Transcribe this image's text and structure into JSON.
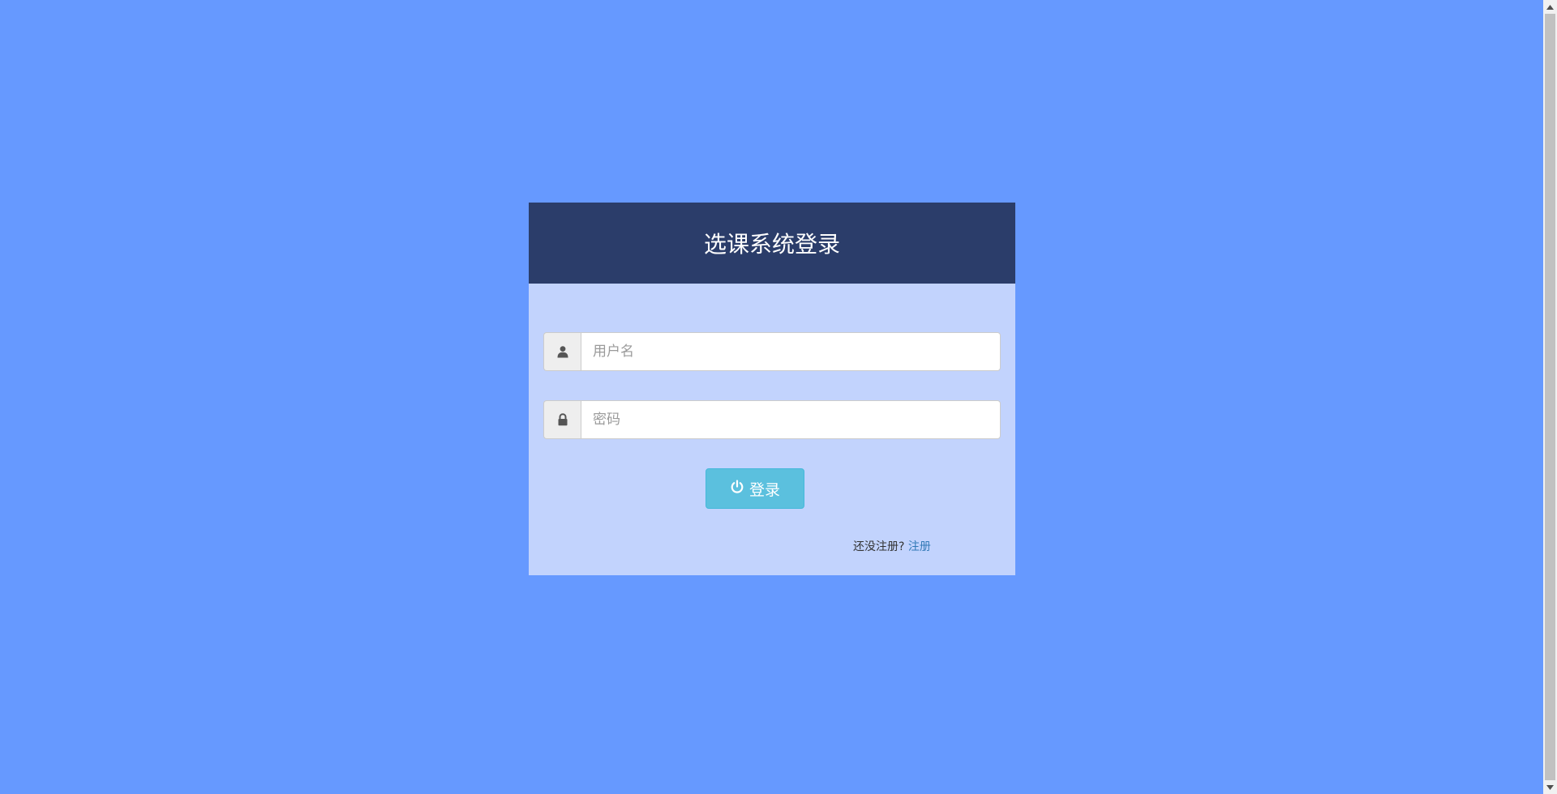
{
  "login": {
    "title": "选课系统登录",
    "username_placeholder": "用户名",
    "password_placeholder": "密码",
    "login_button": "登录",
    "register_prompt": "还没注册?",
    "register_link": "注册"
  },
  "icons": {
    "username": "user-icon",
    "password": "lock-icon",
    "login": "power-icon"
  },
  "colors": {
    "page_background": "#6699ff",
    "header_background": "#2b3d6a",
    "card_background": "#c2d3fd",
    "button_background": "#5bc0de",
    "link": "#337ab7"
  }
}
